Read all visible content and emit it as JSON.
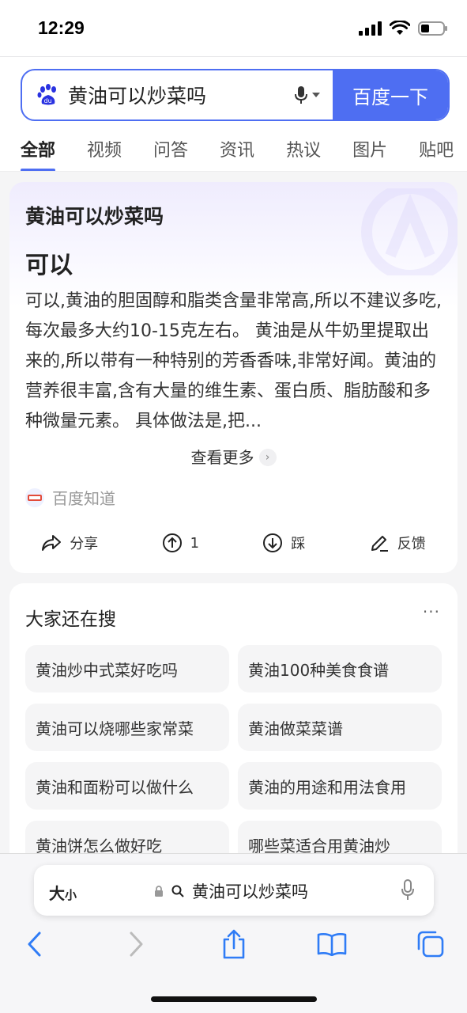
{
  "status_bar": {
    "time": "12:29"
  },
  "search": {
    "query": "黄油可以炒菜吗",
    "button_label": "百度一下"
  },
  "tabs": [
    {
      "label": "全部",
      "active": true
    },
    {
      "label": "视频"
    },
    {
      "label": "问答"
    },
    {
      "label": "资讯"
    },
    {
      "label": "热议"
    },
    {
      "label": "图片"
    },
    {
      "label": "贴吧"
    }
  ],
  "ai_card": {
    "question": "黄油可以炒菜吗",
    "short_answer": "可以",
    "body": "可以,黄油的胆固醇和脂类含量非常高,所以不建议多吃,每次最多大约10-15克左右。 黄油是从牛奶里提取出来的,所以带有一种特别的芳香香味,非常好闻。黄油的营养很丰富,含有大量的维生素、蛋白质、脂肪酸和多种微量元素。 具体做法是,把...",
    "see_more": "查看更多",
    "source": "百度知道",
    "actions": {
      "share": "分享",
      "upvote": "1",
      "downvote": "踩",
      "feedback": "反馈"
    }
  },
  "suggestions": {
    "title": "大家还在搜",
    "more": "···",
    "items": [
      "黄油炒中式菜好吃吗",
      "黄油100种美食食谱",
      "黄油可以烧哪些家常菜",
      "黄油做菜菜谱",
      "黄油和面粉可以做什么",
      "黄油的用途和用法食用",
      "黄油饼怎么做好吃",
      "哪些菜适合用黄油炒"
    ]
  },
  "safari": {
    "text_size_big": "大",
    "text_size_small": "小",
    "address": "黄油可以炒菜吗"
  },
  "colors": {
    "accent": "#4e6ef2"
  }
}
